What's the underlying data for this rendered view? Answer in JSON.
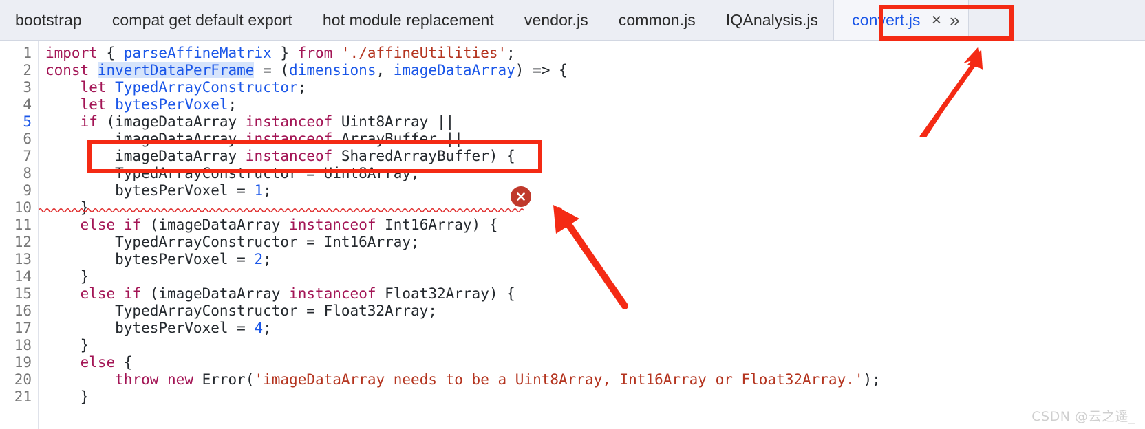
{
  "window": {
    "app": "code-editor",
    "watermark": "CSDN @云之遥_"
  },
  "tabbar": {
    "tabs": [
      {
        "label": "bootstrap",
        "active": false
      },
      {
        "label": "compat get default export",
        "active": false
      },
      {
        "label": "hot module replacement",
        "active": false
      },
      {
        "label": "vendor.js",
        "active": false
      },
      {
        "label": "common.js",
        "active": false
      },
      {
        "label": "IQAnalysis.js",
        "active": false
      },
      {
        "label": "convert.js",
        "active": true
      }
    ],
    "active_tab_close_icon": "×",
    "overflow_icon": "»"
  },
  "editor": {
    "language": "javascript",
    "current_line": 5,
    "gutter_marked_line": "5",
    "line_numbers": [
      "1",
      "2",
      "3",
      "4",
      "5",
      "6",
      "7",
      "8",
      "9",
      "10",
      "11",
      "12",
      "13",
      "14",
      "15",
      "16",
      "17",
      "18",
      "19",
      "20",
      "21"
    ],
    "lines": [
      "import { parseAffineMatrix } from './affineUtilities';",
      "const invertDataPerFrame = (dimensions, imageDataArray) => {",
      "    let TypedArrayConstructor;",
      "    let bytesPerVoxel;",
      "    if (imageDataArray instanceof Uint8Array ||",
      "        imageDataArray instanceof ArrayBuffer ||",
      "        imageDataArray instanceof SharedArrayBuffer) {",
      "        TypedArrayConstructor = Uint8Array;",
      "        bytesPerVoxel = 1;",
      "    }",
      "    else if (imageDataArray instanceof Int16Array) {",
      "        TypedArrayConstructor = Int16Array;",
      "        bytesPerVoxel = 2;",
      "    }",
      "    else if (imageDataArray instanceof Float32Array) {",
      "        TypedArrayConstructor = Float32Array;",
      "        bytesPerVoxel = 4;",
      "    }",
      "    else {",
      "        throw new Error('imageDataArray needs to be a Uint8Array, Int16Array or Float32Array.');",
      "    }"
    ],
    "highlighted_symbol": "invertDataPerFrame",
    "error": {
      "line": 7,
      "icon": "error-circle-x",
      "squiggle_color": "#e03131",
      "badge_color": "#c0392b"
    }
  },
  "annotations": {
    "boxes": [
      {
        "name": "error-line-highlight",
        "color": "#f42a14"
      },
      {
        "name": "active-tab-highlight",
        "color": "#f42a14"
      }
    ],
    "arrows": [
      {
        "name": "arrow-to-active-tab",
        "color": "#f42a14"
      },
      {
        "name": "arrow-to-error-line",
        "color": "#f42a14"
      }
    ]
  },
  "colors": {
    "accent_blue": "#1a56e8",
    "keyword": "#a31555",
    "string": "#b4341f",
    "number": "#1a56e8",
    "tabbar_bg": "#eceef4",
    "annotation_red": "#f42a14"
  }
}
